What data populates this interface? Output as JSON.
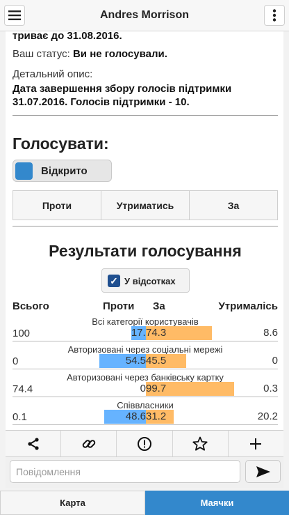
{
  "header": {
    "title": "Andres Morrison",
    "menu_icon": "hamburger-icon",
    "more_icon": "vertical-dots-icon"
  },
  "details": {
    "lasts_until": "триває до 31.08.2016.",
    "status_label": "Ваш статус: ",
    "status_value": "Ви не голосували.",
    "description_label": "Детальний опис:",
    "description_line1": "Дата завершення збору голосів підтримки",
    "description_line2": "31.07.2016. Голосів підтримки - 10."
  },
  "vote": {
    "title": "Голосувати:",
    "toggle_label": "Відкрито",
    "buttons": [
      "Проти",
      "Утриматись",
      "За"
    ]
  },
  "results": {
    "title": "Результати голосування",
    "percent_checkbox_label": "У відсотках",
    "percent_checked": true,
    "columns": {
      "total": "Всього",
      "against": "Проти",
      "for": "За",
      "abstained": "Утрималісь"
    },
    "rows": [
      {
        "label": "Всі категорії користувачів",
        "total": "100",
        "against": 17.2,
        "against_text": "17.2",
        "for": 74.3,
        "for_text": "74.3",
        "abstained": 8.6,
        "abstained_text": "8.6"
      },
      {
        "label": "Авторизовані через соціальні мережі",
        "total": "0",
        "against": 54.5,
        "against_text": "54.5",
        "for": 45.5,
        "for_text": "45.5",
        "abstained": 0,
        "abstained_text": "0"
      },
      {
        "label": "Авторизовані через банківську картку",
        "total": "74.4",
        "against": 0,
        "against_text": "0",
        "for": 99.7,
        "for_text": "99.7",
        "abstained": 0.3,
        "abstained_text": "0.3"
      },
      {
        "label": "Співвласники",
        "total": "0.1",
        "against": 48.6,
        "against_text": "48.6",
        "for": 31.2,
        "for_text": "31.2",
        "abstained": 20.2,
        "abstained_text": "20.2"
      }
    ],
    "colors": {
      "against": "#66b3ff",
      "for": "#ffbb66",
      "abstained": "#aaaaaa"
    }
  },
  "actions": [
    "share-icon",
    "link-icon",
    "alert-circle-icon",
    "star-icon",
    "plus-icon"
  ],
  "message": {
    "placeholder": "Повідомлення"
  },
  "tabs": {
    "map": "Карта",
    "beacons": "Маячки",
    "active_color": "#3388cc"
  }
}
